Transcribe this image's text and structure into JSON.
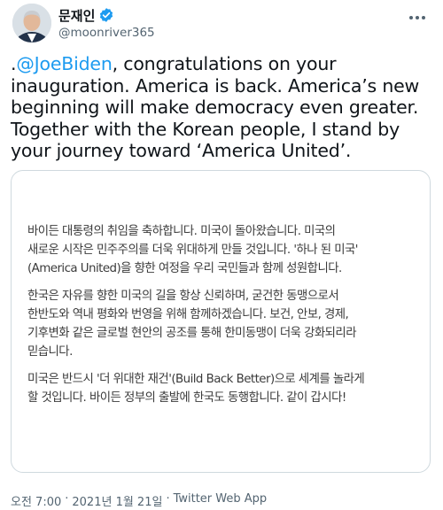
{
  "header": {
    "display_name": "문재인",
    "handle": "@moonriver365",
    "verified_icon": "verified-badge-icon",
    "more_icon": "more-options-icon"
  },
  "tweet": {
    "mention_prefix": ".",
    "mention": "@JoeBiden",
    "text_rest": ", congratulations on your inauguration. America is back. America’s new beginning will make democracy even greater. Together with the Korean people, I stand by your journey toward ‘America United’."
  },
  "letter": {
    "paragraphs": [
      "바이든 대통령의 취임을 축하합니다. 미국이 돌아왔습니다. 미국의\n새로운 시작은 민주주의를 더욱 위대하게 만들 것입니다. '하나 된 미국'\n(America United)을 향한 여정을 우리 국민들과 함께 성원합니다.",
      "한국은 자유를 향한 미국의 길을 항상 신뢰하며, 굳건한 동맹으로서\n한반도와 역내 평화와 번영을 위해 함께하겠습니다. 보건, 안보, 경제,\n기후변화 같은 글로벌 현안의 공조를 통해 한미동맹이 더욱 강화되리라\n믿습니다.",
      "미국은 반드시 '더 위대한 재건'(Build Back Better)으로 세계를 놀라게\n할 것입니다. 바이든 정부의 출발에 한국도 동행합니다. 같이 갑시다!"
    ]
  },
  "footer": {
    "time": "오전 7:00",
    "sep1": "·",
    "date": "2021년 1월 21일",
    "sep2": "·",
    "source": "Twitter Web App"
  },
  "colors": {
    "mention": "#1d9bf0",
    "verified": "#1d9bf0",
    "secondary_text": "#536471"
  }
}
